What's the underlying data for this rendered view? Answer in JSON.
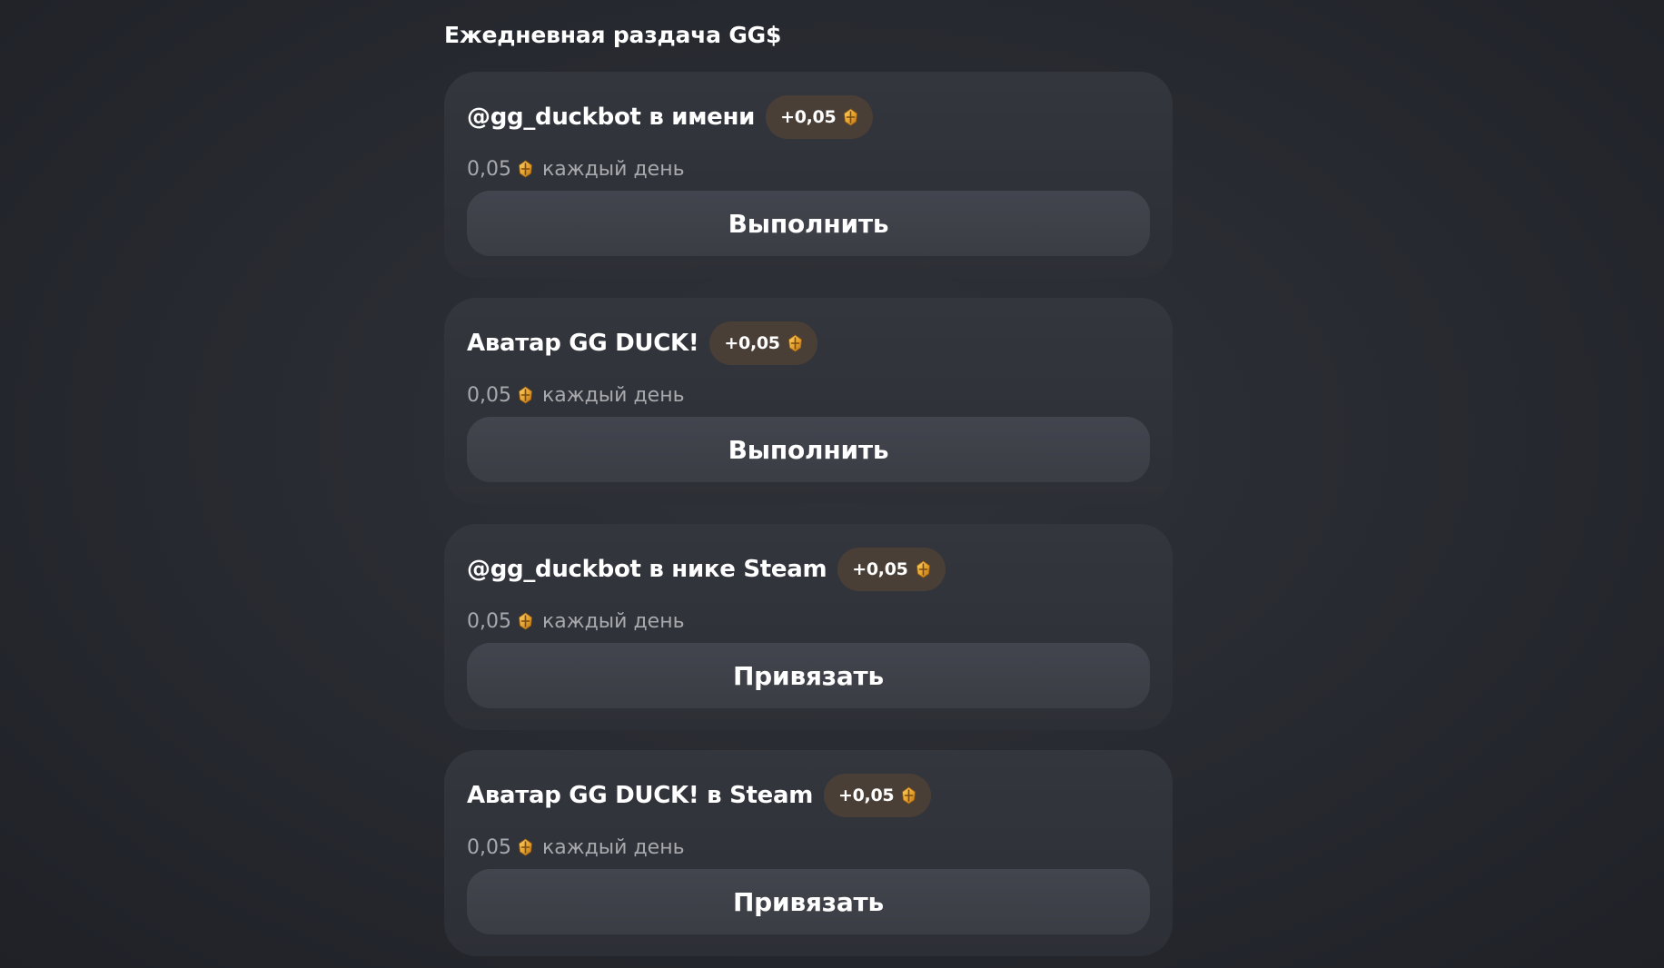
{
  "section": {
    "title": "Ежедневная раздача GG$"
  },
  "coin_icon": "gold-coin-icon",
  "colors": {
    "background": "#2a2c33",
    "card": "#31333a",
    "button": "#40424a",
    "badge": "#4a3f36",
    "coin": "#e0a02a",
    "subtext": "#a8a9ad"
  },
  "tasks": [
    {
      "title": "@gg_duckbot в имени",
      "badge": "+0,05",
      "amount": "0,05",
      "period": "каждый день",
      "action": "Выполнить"
    },
    {
      "title": "Аватар GG DUCK!",
      "badge": "+0,05",
      "amount": "0,05",
      "period": "каждый день",
      "action": "Выполнить"
    },
    {
      "title": "@gg_duckbot в нике Steam",
      "badge": "+0,05",
      "amount": "0,05",
      "period": "каждый день",
      "action": "Привязать"
    },
    {
      "title": "Аватар GG DUCK! в Steam",
      "badge": "+0,05",
      "amount": "0,05",
      "period": "каждый день",
      "action": "Привязать"
    }
  ]
}
